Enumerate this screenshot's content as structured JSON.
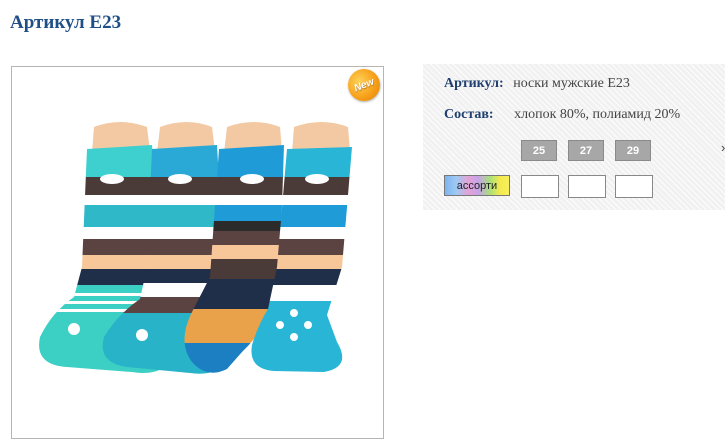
{
  "page": {
    "title": "Артикул E23"
  },
  "product": {
    "badge_text": "New",
    "article_label": "Артикул:",
    "article_value": "носки мужские E23",
    "composition_label": "Состав:",
    "composition_value": "хлопок 80%, полиамид 20%"
  },
  "sizes": [
    "25",
    "27",
    "29"
  ],
  "colors": [
    {
      "label": "ассорти"
    }
  ],
  "quantities": [
    "",
    "",
    ""
  ],
  "panel_nav": {
    "arrow": "›"
  },
  "theme": {
    "title_color": "#1f4f87",
    "label_color": "#1f3f6e",
    "size_chip_bg": "#a7a7a7",
    "badge_color": "#f7a11a"
  }
}
